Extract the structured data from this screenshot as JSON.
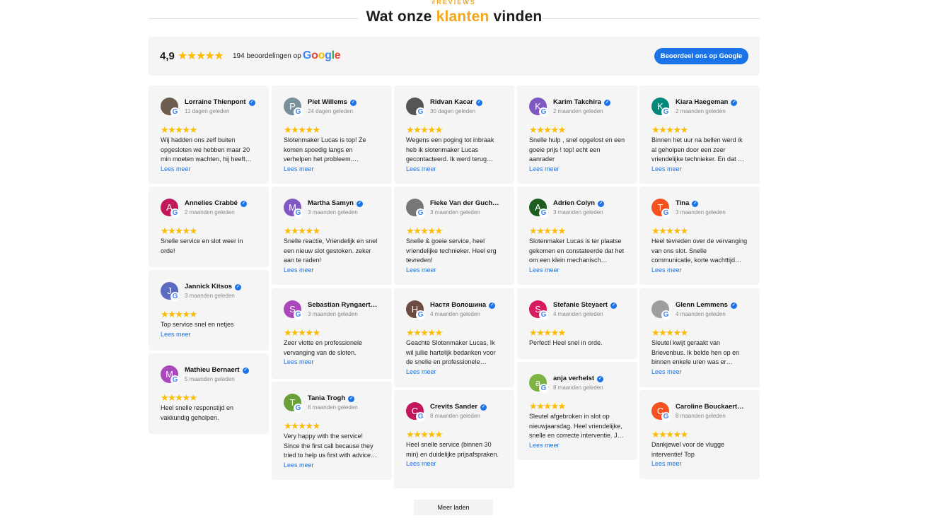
{
  "section": {
    "eyebrow": "#REVIEWS",
    "title_pre": "Wat onze ",
    "title_accent": "klanten",
    "title_post": " vinden"
  },
  "summary": {
    "score": "4,9",
    "count_text": "194 beoordelingen op",
    "google_logo": "Google",
    "rate_button": "Beoordeel ons op Google",
    "rating": 5
  },
  "colors": {
    "accent": "#f2a81d",
    "star": "#fbbc04",
    "link": "#1a73e8"
  },
  "read_more_label": "Lees meer",
  "load_more_label": "Meer laden",
  "columns": [
    [
      {
        "name": "Lorraine Thienpont",
        "date": "11 dagen geleden",
        "initial": "",
        "avatar": "#6d5d4f",
        "text": "Wij hadden ons zelf buiten opgesloten we hebben maar 20 min moeten wachten, hij heeft…",
        "more": true
      },
      {
        "name": "Annelies Crabbé",
        "date": "2 maanden geleden",
        "initial": "A",
        "avatar": "#c2185b",
        "text": "Snelle service en slot weer in orde!",
        "more": false
      },
      {
        "name": "Jannick Kitsos",
        "date": "3 maanden geleden",
        "initial": "J",
        "avatar": "#5c6bc0",
        "text": "Top service snel en netjes",
        "more": true
      },
      {
        "name": "Mathieu Bernaert",
        "date": "5 maanden geleden",
        "initial": "M",
        "avatar": "#ab47bc",
        "text": "Heel snelle responstijd en vakkundig geholpen.",
        "more": false
      }
    ],
    [
      {
        "name": "Piet Willems",
        "date": "24 dagen geleden",
        "initial": "P",
        "avatar": "#78909c",
        "text": "Slotenmaker Lucas is top! Ze komen spoedig langs en verhelpen het probleem.…",
        "more": true
      },
      {
        "name": "Martha Samyn",
        "date": "3 maanden geleden",
        "initial": "M",
        "avatar": "#7e57c2",
        "text": "Snelle reactie, Vriendelijk en snel een nieuw slot gestoken. zeker aan te raden!",
        "more": true
      },
      {
        "name": "Sebastian Ryngaert",
        "date": "3 maanden geleden",
        "initial": "S",
        "avatar": "#ab47bc",
        "text": "Zeer vlotte en professionele vervanging van de sloten.",
        "more": true
      },
      {
        "name": "Tania Trogh",
        "date": "8 maanden geleden",
        "initial": "T",
        "avatar": "#689f38",
        "text": "Very happy with the service! Since the first call because they tried to help us first with advice…",
        "more": true
      }
    ],
    [
      {
        "name": "Ridvan Kacar",
        "date": "30 dagen geleden",
        "initial": "",
        "avatar": "#555555",
        "text": "Wegens een poging tot inbraak heb ik slotenmaker Lucas gecontacteerd. Ik werd terug…",
        "more": true
      },
      {
        "name": "Fieke Van der Gucht",
        "date": "3 maanden geleden",
        "initial": "",
        "avatar": "#777777",
        "text": "Snelle & goeie service, heel vriendelijke technieker. Heel erg tevreden!",
        "more": true
      },
      {
        "name": "Настя Волошина",
        "date": "4 maanden geleden",
        "initial": "H",
        "avatar": "#6d4c41",
        "text": "Geachte Slotenmaker Lucas, Ik wil jullie hartelijk bedanken voor de snelle en professionele…",
        "more": true
      },
      {
        "name": "Crevits Sander",
        "date": "8 maanden geleden",
        "initial": "C",
        "avatar": "#c2185b",
        "text": "Heel snelle service (binnen 30 min) en duidelijke prijsafspraken.",
        "more": true
      }
    ],
    [
      {
        "name": "Karim Takchira",
        "date": "2 maanden geleden",
        "initial": "K",
        "avatar": "#7e57c2",
        "text": "Snelle hulp , snel opgelost en een goeie prijs ! top! echt een aanrader",
        "more": true
      },
      {
        "name": "Adrien Colyn",
        "date": "3 maanden geleden",
        "initial": "A",
        "avatar": "#1b5e20",
        "text": "Slotenmaker Lucas is ter plaatse gekomen en constateerde dat het om een klein mechanisch…",
        "more": true
      },
      {
        "name": "Stefanie Steyaert",
        "date": "4 maanden geleden",
        "initial": "S",
        "avatar": "#d81b60",
        "text": "Perfect! Heel snel in orde.",
        "more": false
      },
      {
        "name": "anja verhelst",
        "date": "8 maanden geleden",
        "initial": "a",
        "avatar": "#7cb342",
        "text": "Sleutel afgebroken in slot op nieuwjaarsdag. Heel vriendelijke, snelle en correcte interventie. J…",
        "more": true
      }
    ],
    [
      {
        "name": "Kiara Haegeman",
        "date": "2 maanden geleden",
        "initial": "K",
        "avatar": "#00897b",
        "text": "Binnen het uur na bellen werd ik al geholpen door een zeer vriendelijke technieker. En dat …",
        "more": true
      },
      {
        "name": "Tina",
        "date": "3 maanden geleden",
        "initial": "T",
        "avatar": "#f4511e",
        "text": "Heel tevreden over de vervanging van ons slot. Snelle communicatie, korte wachttijd…",
        "more": true
      },
      {
        "name": "Glenn Lemmens",
        "date": "4 maanden geleden",
        "initial": "",
        "avatar": "#9e9e9e",
        "text": "Sleutel kwijt geraakt van Brievenbus. Ik belde hen op en binnen enkele uren was er…",
        "more": true
      },
      {
        "name": "Caroline Bouckaert",
        "date": "8 maanden geleden",
        "initial": "C",
        "avatar": "#f4511e",
        "text": "Dankjewel voor de vlugge interventie! Top",
        "more": true
      }
    ]
  ]
}
